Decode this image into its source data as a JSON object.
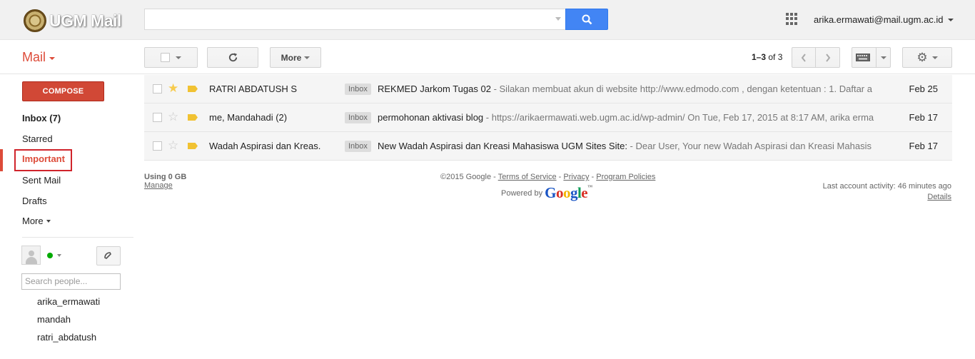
{
  "header": {
    "logo_text": "UGM Mail",
    "search_value": "",
    "account_email": "arika.ermawati@mail.ugm.ac.id"
  },
  "toolbar": {
    "mail_label": "Mail",
    "more_label": "More",
    "pager_range": "1–3",
    "pager_of": "of 3"
  },
  "sidebar": {
    "compose_label": "COMPOSE",
    "items": [
      {
        "label": "Inbox (7)"
      },
      {
        "label": "Starred"
      },
      {
        "label": "Important"
      },
      {
        "label": "Sent Mail"
      },
      {
        "label": "Drafts"
      },
      {
        "label": "More"
      }
    ],
    "search_people_placeholder": "Search people...",
    "contacts": [
      "arika_ermawati",
      "mandah",
      "ratri_abdatush"
    ]
  },
  "messages": [
    {
      "starred": true,
      "sender": "RATRI ABDATUSH S",
      "label": "Inbox",
      "subject": "REKMED Jarkom Tugas 02",
      "snippet": " - Silakan membuat akun di website http://www.edmodo.com , dengan ketentuan : 1. Daftar a",
      "date": "Feb 25"
    },
    {
      "starred": false,
      "sender": "me, Mandahadi (2)",
      "label": "Inbox",
      "subject": "permohonan aktivasi blog",
      "snippet": " - https://arikaermawati.web.ugm.ac.id/wp-admin/ On Tue, Feb 17, 2015 at 8:17 AM, arika erma",
      "date": "Feb 17"
    },
    {
      "starred": false,
      "sender": "Wadah Aspirasi dan Kreas.",
      "label": "Inbox",
      "subject": "New Wadah Aspirasi dan Kreasi Mahasiswa UGM Sites Site:",
      "snippet": " - Dear User, Your new Wadah Aspirasi dan Kreasi Mahasis",
      "date": "Feb 17"
    }
  ],
  "footer": {
    "storage": "Using 0 GB",
    "manage": "Manage",
    "copyright": "©2015 Google - ",
    "terms": "Terms of Service",
    "sep": " - ",
    "privacy": "Privacy",
    "policies": "Program Policies",
    "powered_by": "Powered by",
    "last_activity": "Last account activity: 46 minutes ago",
    "details": "Details"
  },
  "colors": {
    "accent_red": "#dd4b39",
    "compose_red": "#d14836",
    "search_blue": "#4285f4",
    "star_yellow": "#f7cb4d"
  }
}
